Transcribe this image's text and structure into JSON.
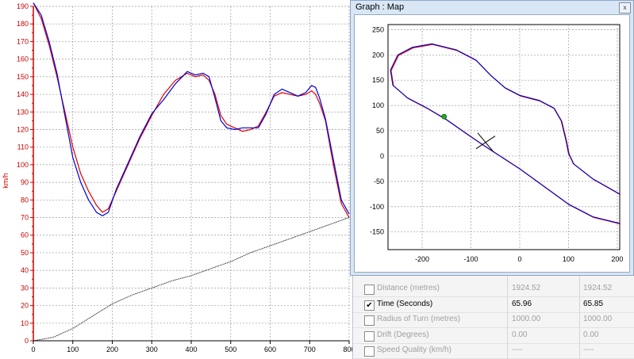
{
  "chart_data": {
    "type": "line",
    "xlabel": "",
    "ylabel": "km/h",
    "xlim": [
      0,
      800
    ],
    "ylim": [
      0,
      190
    ],
    "x_ticks": [
      "0",
      "100",
      "200",
      "300",
      "400",
      "500",
      "600",
      "700",
      "800"
    ],
    "y_ticks": [
      "0",
      "10",
      "20",
      "30",
      "40",
      "50",
      "60",
      "70",
      "80",
      "90",
      "100",
      "110",
      "120",
      "130",
      "140",
      "150",
      "160",
      "170",
      "180",
      "190"
    ],
    "grid": true,
    "series": [
      {
        "color": "#dd0000",
        "x": [
          0,
          20,
          40,
          60,
          80,
          100,
          120,
          140,
          160,
          175,
          190,
          210,
          240,
          270,
          300,
          330,
          360,
          390,
          410,
          430,
          445,
          460,
          475,
          490,
          510,
          530,
          550,
          570,
          590,
          610,
          630,
          650,
          670,
          690,
          705,
          715,
          725,
          740,
          760,
          780,
          800
        ],
        "y": [
          192,
          183,
          168,
          150,
          130,
          110,
          95,
          85,
          77,
          73,
          75,
          85,
          100,
          115,
          128,
          140,
          148,
          152,
          150,
          151,
          148,
          140,
          128,
          123,
          121,
          119,
          120,
          122,
          130,
          139,
          141,
          140,
          139,
          140,
          142,
          140,
          135,
          125,
          100,
          78,
          70
        ]
      },
      {
        "color": "#0000dd",
        "x": [
          0,
          20,
          40,
          60,
          80,
          100,
          120,
          140,
          160,
          175,
          190,
          210,
          240,
          270,
          300,
          330,
          360,
          390,
          410,
          430,
          445,
          460,
          475,
          490,
          510,
          530,
          550,
          570,
          590,
          610,
          630,
          650,
          670,
          690,
          705,
          715,
          725,
          740,
          760,
          780,
          800
        ],
        "y": [
          192,
          185,
          170,
          152,
          128,
          104,
          90,
          80,
          73,
          71,
          73,
          86,
          101,
          116,
          129,
          137,
          146,
          153,
          151,
          152,
          150,
          138,
          125,
          121,
          120,
          121,
          121,
          121,
          129,
          140,
          143,
          141,
          139,
          141,
          145,
          144,
          138,
          126,
          103,
          80,
          72
        ]
      },
      {
        "color": "#333333",
        "x": [
          0,
          50,
          100,
          150,
          200,
          250,
          300,
          350,
          400,
          450,
          500,
          550,
          600,
          650,
          700,
          750,
          800
        ],
        "y": [
          0,
          2,
          7,
          14,
          21,
          26,
          30,
          34,
          37,
          41,
          45,
          50,
          54,
          58,
          62,
          66,
          70
        ]
      }
    ]
  },
  "map_window": {
    "title": "Graph : Map",
    "close_label": "x",
    "chart_data": {
      "type": "line",
      "xlim": [
        -270,
        205
      ],
      "ylim": [
        -185,
        260
      ],
      "x_ticks": [
        "-200",
        "-100",
        "0",
        "100",
        "200"
      ],
      "y_ticks": [
        "250",
        "200",
        "150",
        "100",
        "50",
        "0",
        "-50",
        "-100",
        "-150"
      ],
      "grid": true,
      "track": [
        [
          205,
          -75
        ],
        [
          150,
          -45
        ],
        [
          110,
          -15
        ],
        [
          100,
          5
        ],
        [
          95,
          30
        ],
        [
          85,
          70
        ],
        [
          70,
          95
        ],
        [
          40,
          110
        ],
        [
          0,
          120
        ],
        [
          -30,
          135
        ],
        [
          -60,
          160
        ],
        [
          -90,
          190
        ],
        [
          -130,
          210
        ],
        [
          -180,
          222
        ],
        [
          -220,
          215
        ],
        [
          -250,
          200
        ],
        [
          -265,
          170
        ],
        [
          -260,
          140
        ],
        [
          -230,
          115
        ],
        [
          -190,
          95
        ],
        [
          -150,
          72
        ],
        [
          -110,
          45
        ],
        [
          -75,
          22
        ],
        [
          -40,
          0
        ],
        [
          0,
          -25
        ],
        [
          50,
          -60
        ],
        [
          100,
          -95
        ],
        [
          150,
          -120
        ],
        [
          205,
          -133
        ]
      ],
      "start_marker": [
        -155,
        78
      ],
      "cursor_marker": [
        -70,
        27
      ]
    }
  },
  "table": {
    "rows": [
      {
        "name": "Distance (metres)",
        "v1": "1924.52",
        "v2": "1924.52",
        "checked": false,
        "enabled": false
      },
      {
        "name": "Time (Seconds)",
        "v1": "65.96",
        "v2": "65.85",
        "checked": true,
        "enabled": true
      },
      {
        "name": "Radius of Turn (metres)",
        "v1": "1000.00",
        "v2": "1000.00",
        "checked": false,
        "enabled": false
      },
      {
        "name": "Drift (Degrees)",
        "v1": "0.00",
        "v2": "0.00",
        "checked": false,
        "enabled": false
      },
      {
        "name": "Speed Quality (km/h)",
        "v1": "----",
        "v2": "----",
        "checked": false,
        "enabled": false
      }
    ]
  }
}
